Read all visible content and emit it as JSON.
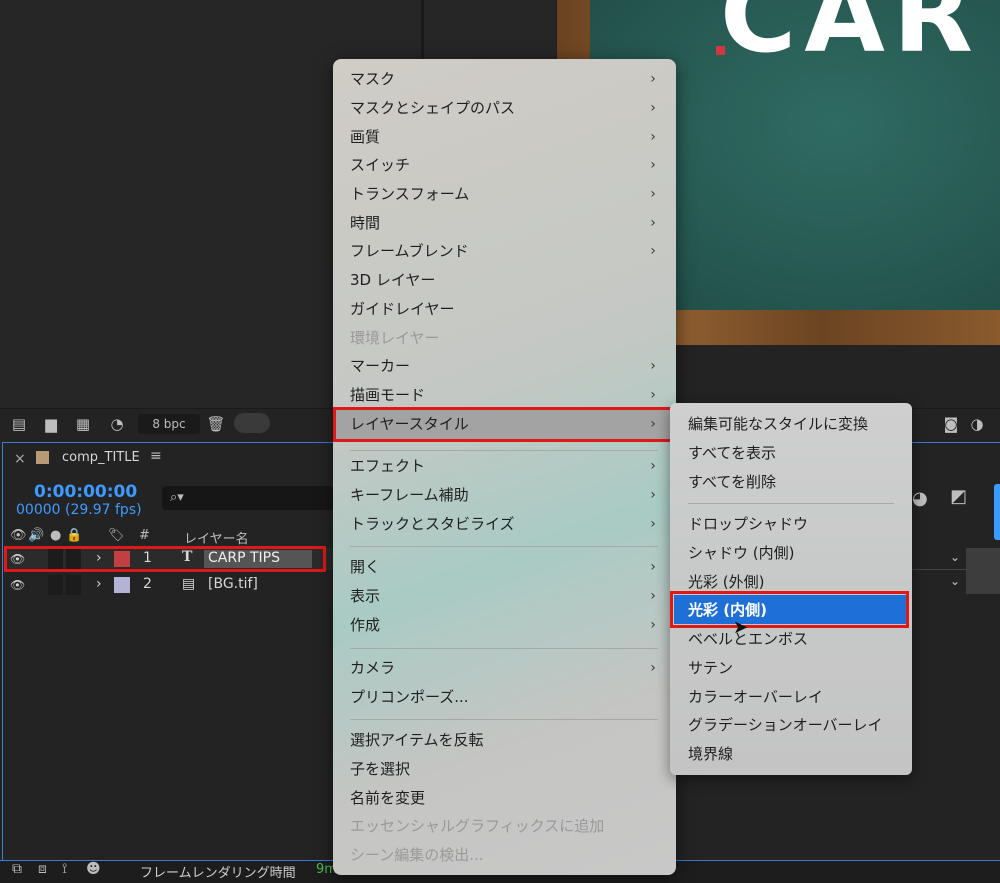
{
  "viewer": {
    "title_text": "CAR",
    "bpc": "8 bpc"
  },
  "timeline": {
    "comp_name": "comp_TITLE",
    "timecode": "0:00:00:00",
    "frames_fps": "00000 (29.97 fps)",
    "search_placeholder": "",
    "column_num": "#",
    "column_layer_name": "レイヤー名",
    "layers": [
      {
        "num": "1",
        "type_icon": "T",
        "name": "CARP TIPS",
        "label_color": "#c24040"
      },
      {
        "num": "2",
        "type_icon": "file-icon",
        "name": "[BG.tif]",
        "label_color": "#b3b3d6"
      }
    ]
  },
  "status_bar": {
    "label": "フレームレンダリング時間",
    "value": "9m"
  },
  "context_menu": {
    "items": [
      {
        "label": "マスク",
        "submenu": true
      },
      {
        "label": "マスクとシェイプのパス",
        "submenu": true
      },
      {
        "label": "画質",
        "submenu": true
      },
      {
        "label": "スイッチ",
        "submenu": true
      },
      {
        "label": "トランスフォーム",
        "submenu": true
      },
      {
        "label": "時間",
        "submenu": true
      },
      {
        "label": "フレームブレンド",
        "submenu": true
      },
      {
        "label": "3D レイヤー",
        "submenu": false
      },
      {
        "label": "ガイドレイヤー",
        "submenu": false
      },
      {
        "label": "環境レイヤー",
        "submenu": false,
        "disabled": true
      },
      {
        "label": "マーカー",
        "submenu": true
      },
      {
        "label": "描画モード",
        "submenu": true
      },
      {
        "label": "レイヤースタイル",
        "submenu": true,
        "highlighted": true
      },
      {
        "label": "エフェクト",
        "submenu": true
      },
      {
        "label": "キーフレーム補助",
        "submenu": true
      },
      {
        "label": "トラックとスタビライズ",
        "submenu": true
      },
      {
        "label": "開く",
        "submenu": true
      },
      {
        "label": "表示",
        "submenu": true
      },
      {
        "label": "作成",
        "submenu": true
      },
      {
        "label": "カメラ",
        "submenu": true
      },
      {
        "label": "プリコンポーズ...",
        "submenu": false
      },
      {
        "label": "選択アイテムを反転",
        "submenu": false
      },
      {
        "label": "子を選択",
        "submenu": false
      },
      {
        "label": "名前を変更",
        "submenu": false
      },
      {
        "label": "エッセンシャルグラフィックスに追加",
        "submenu": false,
        "disabled": true
      },
      {
        "label": "シーン編集の検出...",
        "submenu": false,
        "disabled": true
      }
    ]
  },
  "layer_style_submenu": {
    "items": [
      {
        "label": "編集可能なスタイルに変換"
      },
      {
        "label": "すべてを表示"
      },
      {
        "label": "すべてを削除"
      },
      {
        "label": "ドロップシャドウ"
      },
      {
        "label": "シャドウ (内側)"
      },
      {
        "label": "光彩 (外側)"
      },
      {
        "label": "光彩 (内側)",
        "highlighted": true
      },
      {
        "label": "ベベルとエンボス"
      },
      {
        "label": "サテン"
      },
      {
        "label": "カラーオーバーレイ"
      },
      {
        "label": "グラデーションオーバーレイ"
      },
      {
        "label": "境界線"
      }
    ]
  },
  "colors": {
    "accent_blue": "#1e6fd8",
    "timecode_blue": "#3d9bff",
    "annotation_red": "#e01818"
  }
}
